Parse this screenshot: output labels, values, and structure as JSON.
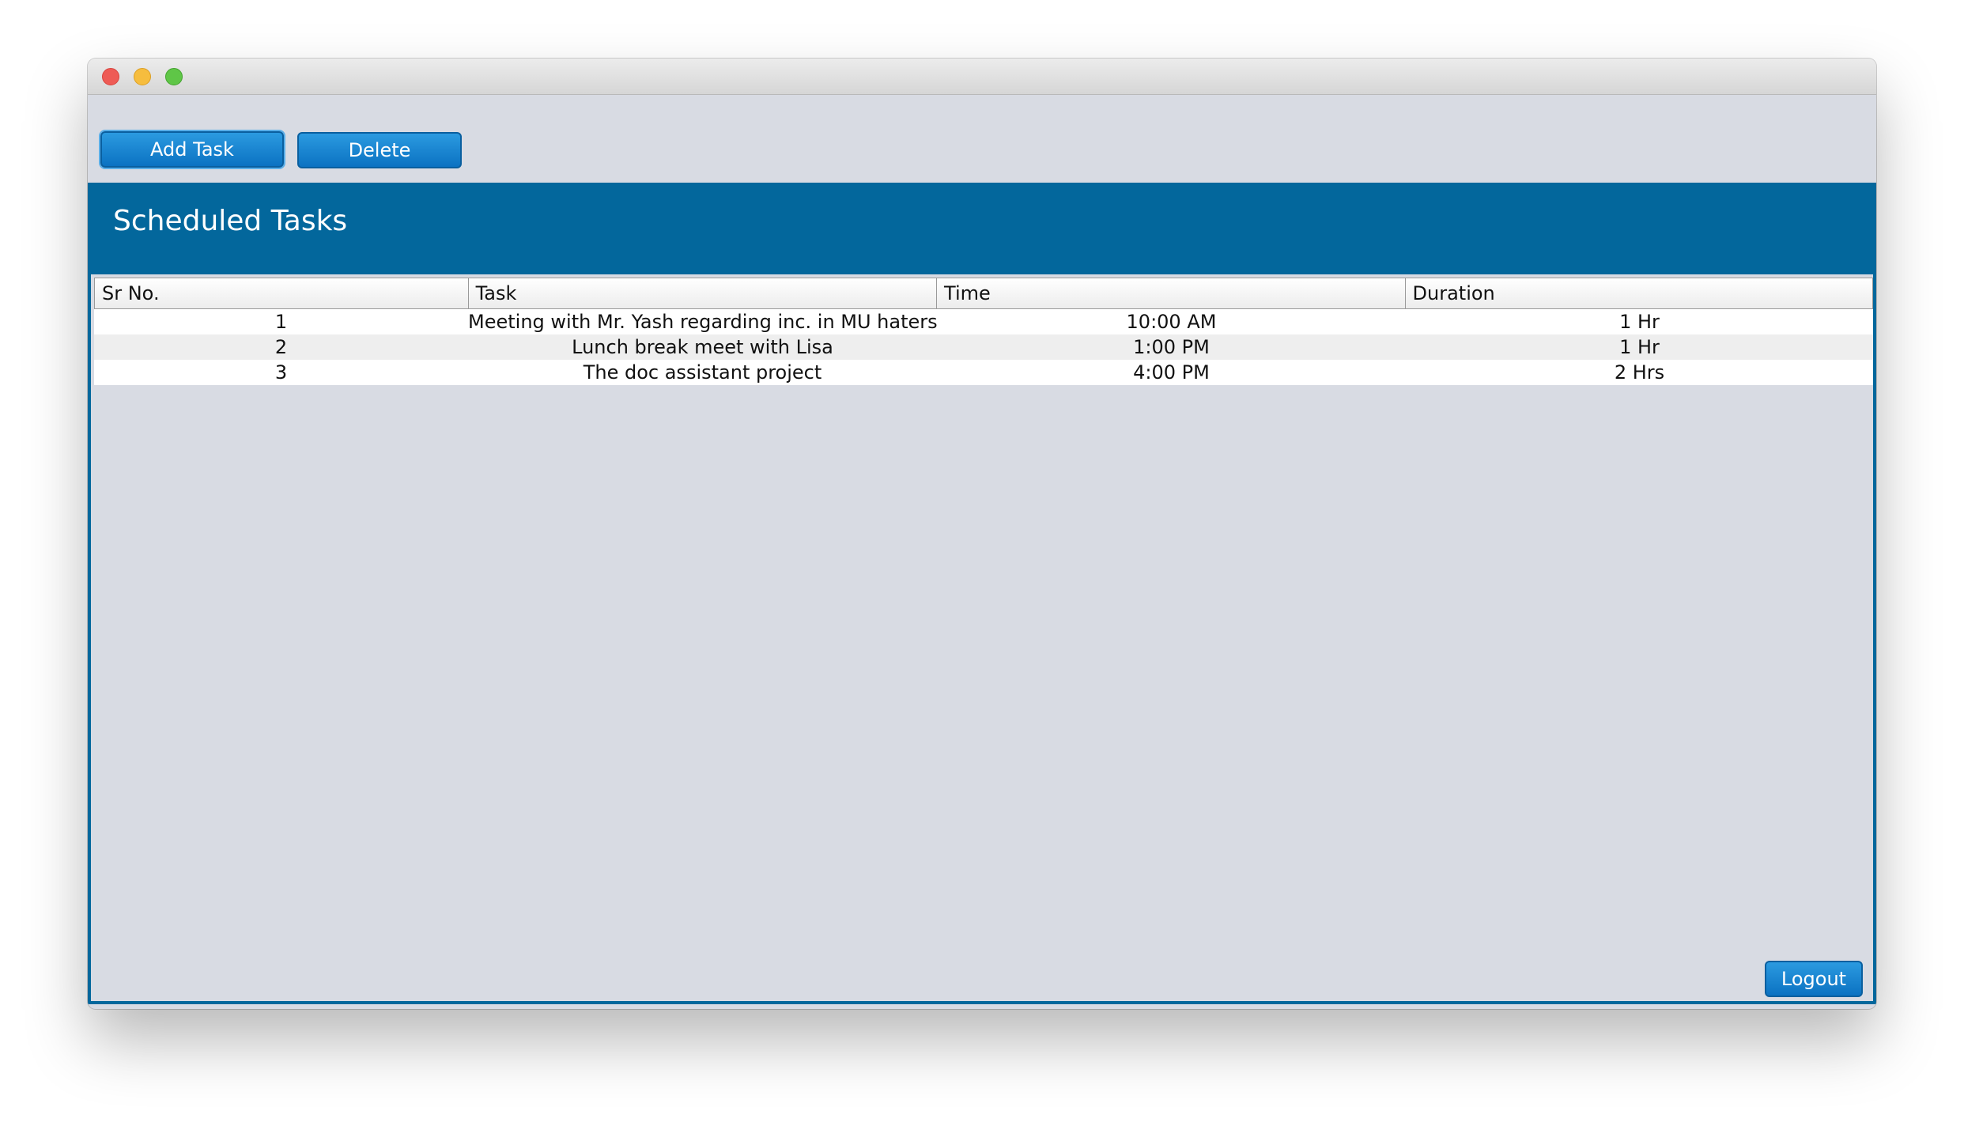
{
  "window": {
    "buttons": {
      "add_task": "Add Task",
      "delete": "Delete",
      "logout": "Logout"
    }
  },
  "header": {
    "title": "Scheduled Tasks"
  },
  "table": {
    "columns": [
      "Sr No.",
      "Task",
      "Time",
      "Duration"
    ],
    "rows": [
      [
        "1",
        "Meeting with Mr. Yash regarding inc. in MU haters",
        "10:00 AM",
        "1 Hr"
      ],
      [
        "2",
        "Lunch break meet with Lisa",
        "1:00 PM",
        "1 Hr"
      ],
      [
        "3",
        "The doc assistant project",
        "4:00 PM",
        "2 Hrs"
      ]
    ]
  },
  "colors": {
    "accent": "#03679c",
    "button": "#0b72c2",
    "window_bg": "#d8dbe3"
  }
}
